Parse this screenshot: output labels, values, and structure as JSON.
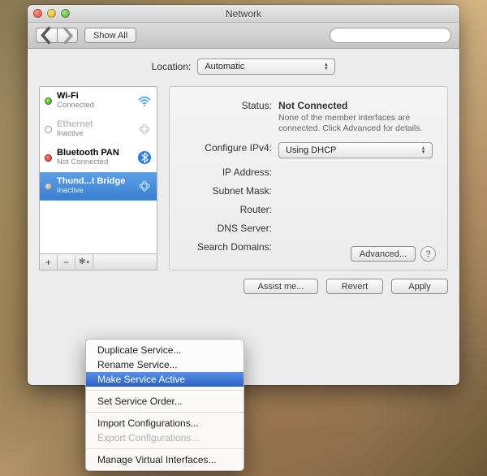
{
  "window": {
    "title": "Network"
  },
  "toolbar": {
    "show_all": "Show All",
    "search_placeholder": ""
  },
  "location": {
    "label": "Location:",
    "value": "Automatic"
  },
  "services": [
    {
      "name": "Wi-Fi",
      "status": "Connected",
      "dot": "green",
      "icon": "wifi",
      "dim": false,
      "sel": false
    },
    {
      "name": "Ethernet",
      "status": "Inactive",
      "dot": "off",
      "icon": "ethernet",
      "dim": true,
      "sel": false
    },
    {
      "name": "Bluetooth PAN",
      "status": "Not Connected",
      "dot": "red",
      "icon": "bluetooth",
      "dim": false,
      "sel": false
    },
    {
      "name": "Thund...t Bridge",
      "status": "Inactive",
      "dot": "grey",
      "icon": "thunderbolt",
      "dim": false,
      "sel": true
    }
  ],
  "detail": {
    "status_label": "Status:",
    "status_value": "Not Connected",
    "status_note": "None of the member interfaces are connected. Click Advanced for details.",
    "config_label": "Configure IPv4:",
    "config_value": "Using DHCP",
    "ip_label": "IP Address:",
    "subnet_label": "Subnet Mask:",
    "router_label": "Router:",
    "dns_label": "DNS Server:",
    "search_label": "Search Domains:",
    "advanced": "Advanced..."
  },
  "buttons": {
    "assist": "Assist me...",
    "revert": "Revert",
    "apply": "Apply"
  },
  "gear_menu": {
    "duplicate": "Duplicate Service...",
    "rename": "Rename Service...",
    "make_active": "Make Service Active",
    "order": "Set Service Order...",
    "import": "Import Configurations...",
    "export": "Export Configurations...",
    "manage": "Manage Virtual Interfaces..."
  }
}
